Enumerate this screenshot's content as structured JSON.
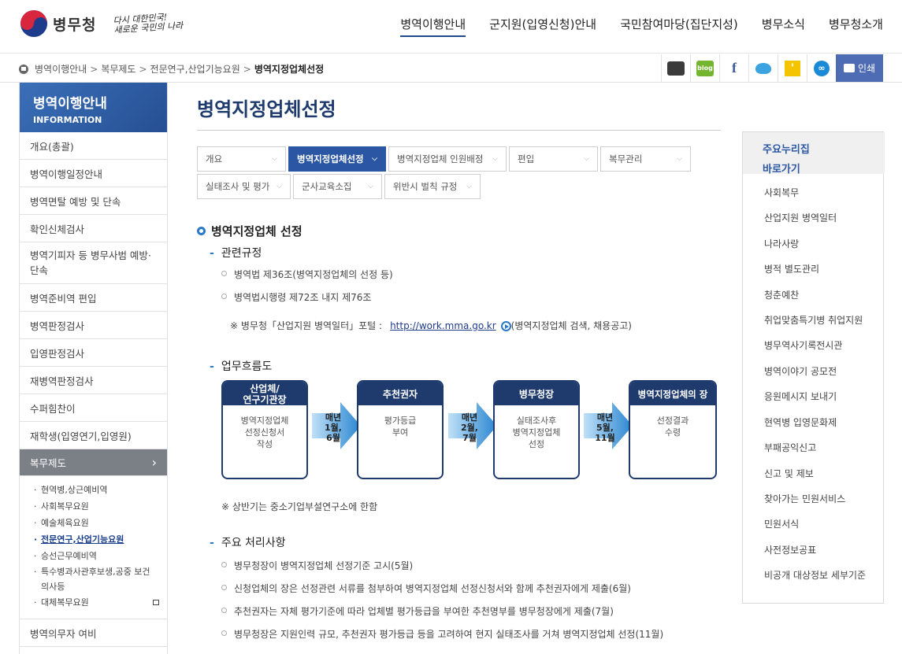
{
  "header": {
    "logo_text": "병무청",
    "slogan": "다시 대한민국!\n새로운 국민의 나라",
    "gnb": [
      "병역이행안내",
      "군지원(입영신청)안내",
      "국민참여마당(집단지성)",
      "병무소식",
      "병무청소개"
    ]
  },
  "breadcrumb": [
    "병역이행안내",
    "복무제도",
    "전문연구,산업기능요원",
    "병역지정업체선정"
  ],
  "share": {
    "blog_label": "blog",
    "facebook_label": "f",
    "kakaostory_label": "'",
    "link_label": "∞",
    "print_label": "인쇄"
  },
  "lnb": {
    "title": "병역이행안내",
    "subtitle": "INFORMATION",
    "items": [
      "개요(총괄)",
      "병역이행일정안내",
      "병역면탈 예방 및 단속",
      "확인신체검사",
      "병역기피자 등 병무사범 예방·단속",
      "병역준비역 편입",
      "병역판정검사",
      "입영판정검사",
      "재병역판정검사",
      "수퍼힘찬이",
      "재학생(입영연기,입영원)"
    ],
    "active": "복무제도",
    "active_arrow": "›",
    "sub": [
      "현역병,상근예비역",
      "사회복무요원",
      "예술체육요원",
      "전문연구,산업기능요원",
      "승선근무예비역",
      "특수병과사관후보생,공중 보건의사등",
      "대체복무요원"
    ],
    "after": "병역의무자 여비"
  },
  "main": {
    "title": "병역지정업체선정",
    "tabs": [
      "개요",
      "병역지정업체선정",
      "병역지정업체 인원배정",
      "편입",
      "복무관리",
      "실태조사 및 평가",
      "군사교육소집",
      "위반시 벌칙 규정"
    ],
    "tab_chevron": "⌵",
    "section_title": "병역지정업체 선정",
    "rules_title": "관련규정",
    "rules": [
      "병역법 제36조(병역지정업체의 선정 등)",
      "병역법시행령 제72조 내지 제76조"
    ],
    "portal_note_prefix": "※ 병무청「산업지원 병역일터」포털 :",
    "portal_url": "http://work.mma.go.kr",
    "portal_note_suffix": "(병역지정업체 검색, 채용공고)",
    "flow_title": "업무흐름도",
    "flow": [
      {
        "head": "산업체/\n연구기관장",
        "body": "병역지정업체\n선정신청서\n작성"
      },
      {
        "head": "추천권자",
        "body": "평가등급\n부여"
      },
      {
        "head": "병무청장",
        "body": "실태조사후\n병역지정업체\n선정"
      },
      {
        "head": "병역지정업체의 장",
        "body": "선정결과\n수령"
      }
    ],
    "flow_arrows": [
      "매년\n1월,\n6월",
      "매년\n2월,\n7월",
      "매년\n5월,\n11월"
    ],
    "flow_note": "※ 상반기는 중소기업부설연구소에 한함",
    "tasks_title": "주요 처리사항",
    "tasks": [
      "병무청장이 병역지정업체 선정기준 고시(5월)",
      "신청업체의 장은 선정관련 서류를 첨부하여 병역지정업체 선정신청서와 함께 추천권자에게 제출(6월)",
      "추천권자는 자체 평가기준에 따라 업체별 평가등급을 부여한 추천명부를 병무청장에게 제출(7월)",
      "병무청장은 지원인력 규모, 추천권자 평가등급 등을 고려하여 현지 실태조사를 거쳐 병역지정업체 선정(11월)"
    ]
  },
  "aside": {
    "title": "주요누리집\n바로가기",
    "items": [
      "사회복무",
      "산업지원 병역일터",
      "나라사랑",
      "병적 별도관리",
      "청춘예찬",
      "취업맞춤특기병 취업지원",
      "병무역사기록전시관",
      "병역이야기 공모전",
      "응원메시지 보내기",
      "현역병 입영문화제",
      "부패공익신고",
      "신고 및 제보",
      "찾아가는 민원서비스",
      "민원서식",
      "사전정보공표",
      "비공개 대상정보 세부기준"
    ]
  },
  "colors": {
    "brand_blue": "#1f3b6e",
    "accent_blue": "#2a56a3",
    "lnb_active": "#7b7f86"
  }
}
